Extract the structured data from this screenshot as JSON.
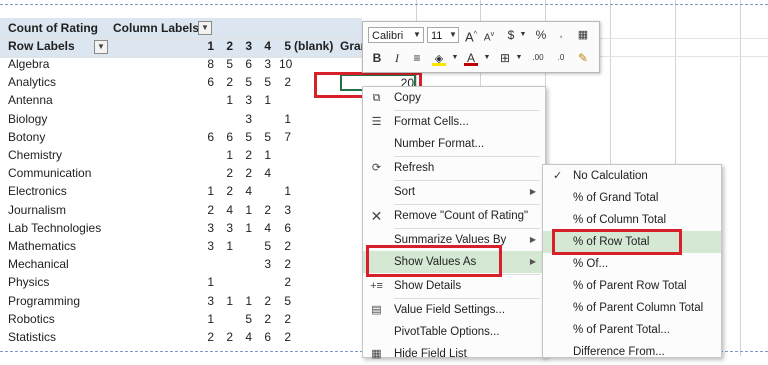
{
  "pivot": {
    "count_label": "Count of Rating",
    "column_labels": "Column Labels",
    "row_labels": "Row Labels",
    "grand_partial": "Gran",
    "col_headers": [
      "1",
      "2",
      "3",
      "4",
      "5",
      "(blank)"
    ],
    "rows": [
      {
        "label": "Algebra",
        "v": [
          "8",
          "5",
          "6",
          "3",
          "10"
        ]
      },
      {
        "label": "Analytics",
        "v": [
          "6",
          "2",
          "5",
          "5",
          "2"
        ]
      },
      {
        "label": "Antenna",
        "v": [
          "",
          "1",
          "3",
          "1",
          ""
        ]
      },
      {
        "label": "Biology",
        "v": [
          "",
          "",
          "3",
          "",
          "1"
        ]
      },
      {
        "label": "Botony",
        "v": [
          "6",
          "6",
          "5",
          "5",
          "7"
        ]
      },
      {
        "label": "Chemistry",
        "v": [
          "",
          "1",
          "2",
          "1",
          ""
        ]
      },
      {
        "label": "Communication",
        "v": [
          "",
          "2",
          "2",
          "4",
          ""
        ]
      },
      {
        "label": "Electronics",
        "v": [
          "1",
          "2",
          "4",
          "",
          "1"
        ]
      },
      {
        "label": "Journalism",
        "v": [
          "2",
          "4",
          "1",
          "2",
          "3"
        ]
      },
      {
        "label": "Lab Technologies",
        "v": [
          "3",
          "3",
          "1",
          "4",
          "6"
        ]
      },
      {
        "label": "Mathematics",
        "v": [
          "3",
          "1",
          "",
          "5",
          "2"
        ]
      },
      {
        "label": "Mechanical",
        "v": [
          "",
          "",
          "",
          "3",
          "2"
        ]
      },
      {
        "label": "Physics",
        "v": [
          "1",
          "",
          "",
          "",
          "2"
        ]
      },
      {
        "label": "Programming",
        "v": [
          "3",
          "1",
          "1",
          "2",
          "5"
        ]
      },
      {
        "label": "Robotics",
        "v": [
          "1",
          "",
          "5",
          "2",
          "2"
        ]
      },
      {
        "label": "Statistics",
        "v": [
          "2",
          "2",
          "4",
          "6",
          "2"
        ]
      }
    ],
    "active_cell_value": "20"
  },
  "mini_toolbar": {
    "font_name": "Calibri",
    "font_size": "11",
    "grow_font": "A",
    "shrink_font": "A",
    "currency": "$",
    "percent": "%",
    "bold": "B",
    "italic": "I",
    "font_color_letter": "A",
    "decimals_inc": ".00",
    "decimals_dec": ".0"
  },
  "context_menu": {
    "items": [
      {
        "label": "Copy",
        "icon": "copy-icon"
      },
      {
        "label": "Format Cells...",
        "icon": "format-cells-icon"
      },
      {
        "label": "Number Format...",
        "icon": ""
      },
      {
        "label": "Refresh",
        "icon": "refresh-icon"
      },
      {
        "label": "Sort",
        "icon": ""
      },
      {
        "label": "Remove \"Count of Rating\"",
        "icon": "remove-x-icon"
      },
      {
        "label": "Summarize Values By",
        "icon": ""
      },
      {
        "label": "Show Values As",
        "icon": ""
      },
      {
        "label": "Show Details",
        "icon": "show-details-icon"
      },
      {
        "label": "Value Field Settings...",
        "icon": "field-settings-icon"
      },
      {
        "label": "PivotTable Options...",
        "icon": ""
      },
      {
        "label": "Hide Field List",
        "icon": "field-list-icon"
      }
    ]
  },
  "submenu": {
    "checkmark": "✓",
    "items": [
      {
        "label": "No Calculation"
      },
      {
        "label": "% of Grand Total"
      },
      {
        "label": "% of Column Total"
      },
      {
        "label": "% of Row Total"
      },
      {
        "label": "% Of..."
      },
      {
        "label": "% of Parent Row Total"
      },
      {
        "label": "% of Parent Column Total"
      },
      {
        "label": "% of Parent Total..."
      },
      {
        "label": "Difference From..."
      }
    ]
  },
  "colors": {
    "header_band": "#dce6f1",
    "highlight": "#d5e8d4",
    "red_outline": "#d7202a",
    "font_color_bar": "#c00000",
    "fill_color_bar": "#ffe600"
  }
}
